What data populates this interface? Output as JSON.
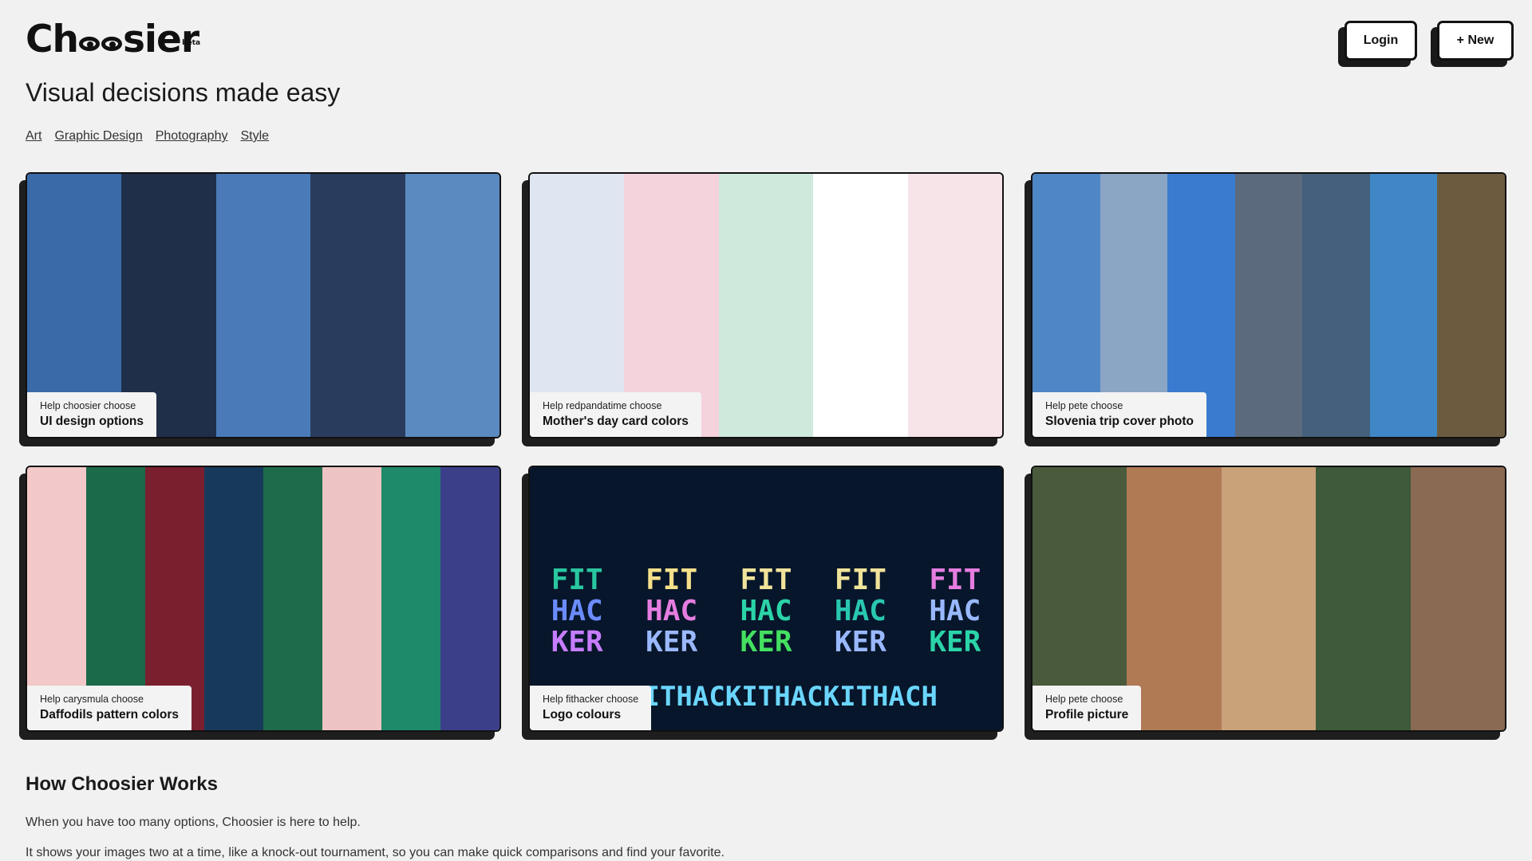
{
  "logo": {
    "text_left": "Ch",
    "text_right": "sier",
    "badge": "beta"
  },
  "nav": {
    "login": "Login",
    "new": "+ New"
  },
  "tagline": "Visual decisions made easy",
  "categories": [
    "Art",
    "Graphic Design",
    "Photography",
    "Style"
  ],
  "cards": [
    {
      "help": "Help choosier choose",
      "title": "UI design options",
      "colors": [
        "#3b6aa8",
        "#1f2f4a",
        "#4a7bb8",
        "#2a3c5e",
        "#5a8ac0"
      ]
    },
    {
      "help": "Help redpandatime choose",
      "title": "Mother's day card colors",
      "colors": [
        "#dfe6f2",
        "#f5d3dc",
        "#cfe9dc",
        "#ffffff",
        "#f7e4e8"
      ]
    },
    {
      "help": "Help pete choose",
      "title": "Slovenia trip cover photo",
      "colors": [
        "#4f86c6",
        "#8aa6c4",
        "#3a7bd0",
        "#5b6a7c",
        "#44607c",
        "#3f87c6",
        "#6c5b3e"
      ]
    },
    {
      "help": "Help carysmula choose",
      "title": "Daffodils pattern colors",
      "colors": [
        "#f3c8c8",
        "#1b6a4a",
        "#7a1f2e",
        "#173a5c",
        "#1d6b4a",
        "#eec3c3",
        "#1f8a6a",
        "#3b3f8a"
      ]
    },
    {
      "help": "Help fithacker choose",
      "title": "Logo colours",
      "colors": [
        "#07162a",
        "#07162a",
        "#07162a",
        "#07162a",
        "#07162a"
      ],
      "fit": [
        [
          "FIT",
          "HAC",
          "KER"
        ],
        [
          "FIT",
          "HAC",
          "KER"
        ],
        [
          "FIT",
          "HAC",
          "KER"
        ],
        [
          "FIT",
          "HAC",
          "KER"
        ],
        [
          "FIT",
          "HAC",
          "KER"
        ]
      ],
      "hack": "ACKITHACKITHACKITHACH"
    },
    {
      "help": "Help pete choose",
      "title": "Profile picture",
      "colors": [
        "#4a5a3c",
        "#b07a55",
        "#c9a27a",
        "#3e5a3a",
        "#8a6a52"
      ]
    }
  ],
  "how_title": "How Choosier Works",
  "how_p1": "When you have too many options, Choosier is here to help.",
  "how_p2": "It shows your images two at a time, like a knock-out tournament, so you can make quick comparisons and find your favorite."
}
